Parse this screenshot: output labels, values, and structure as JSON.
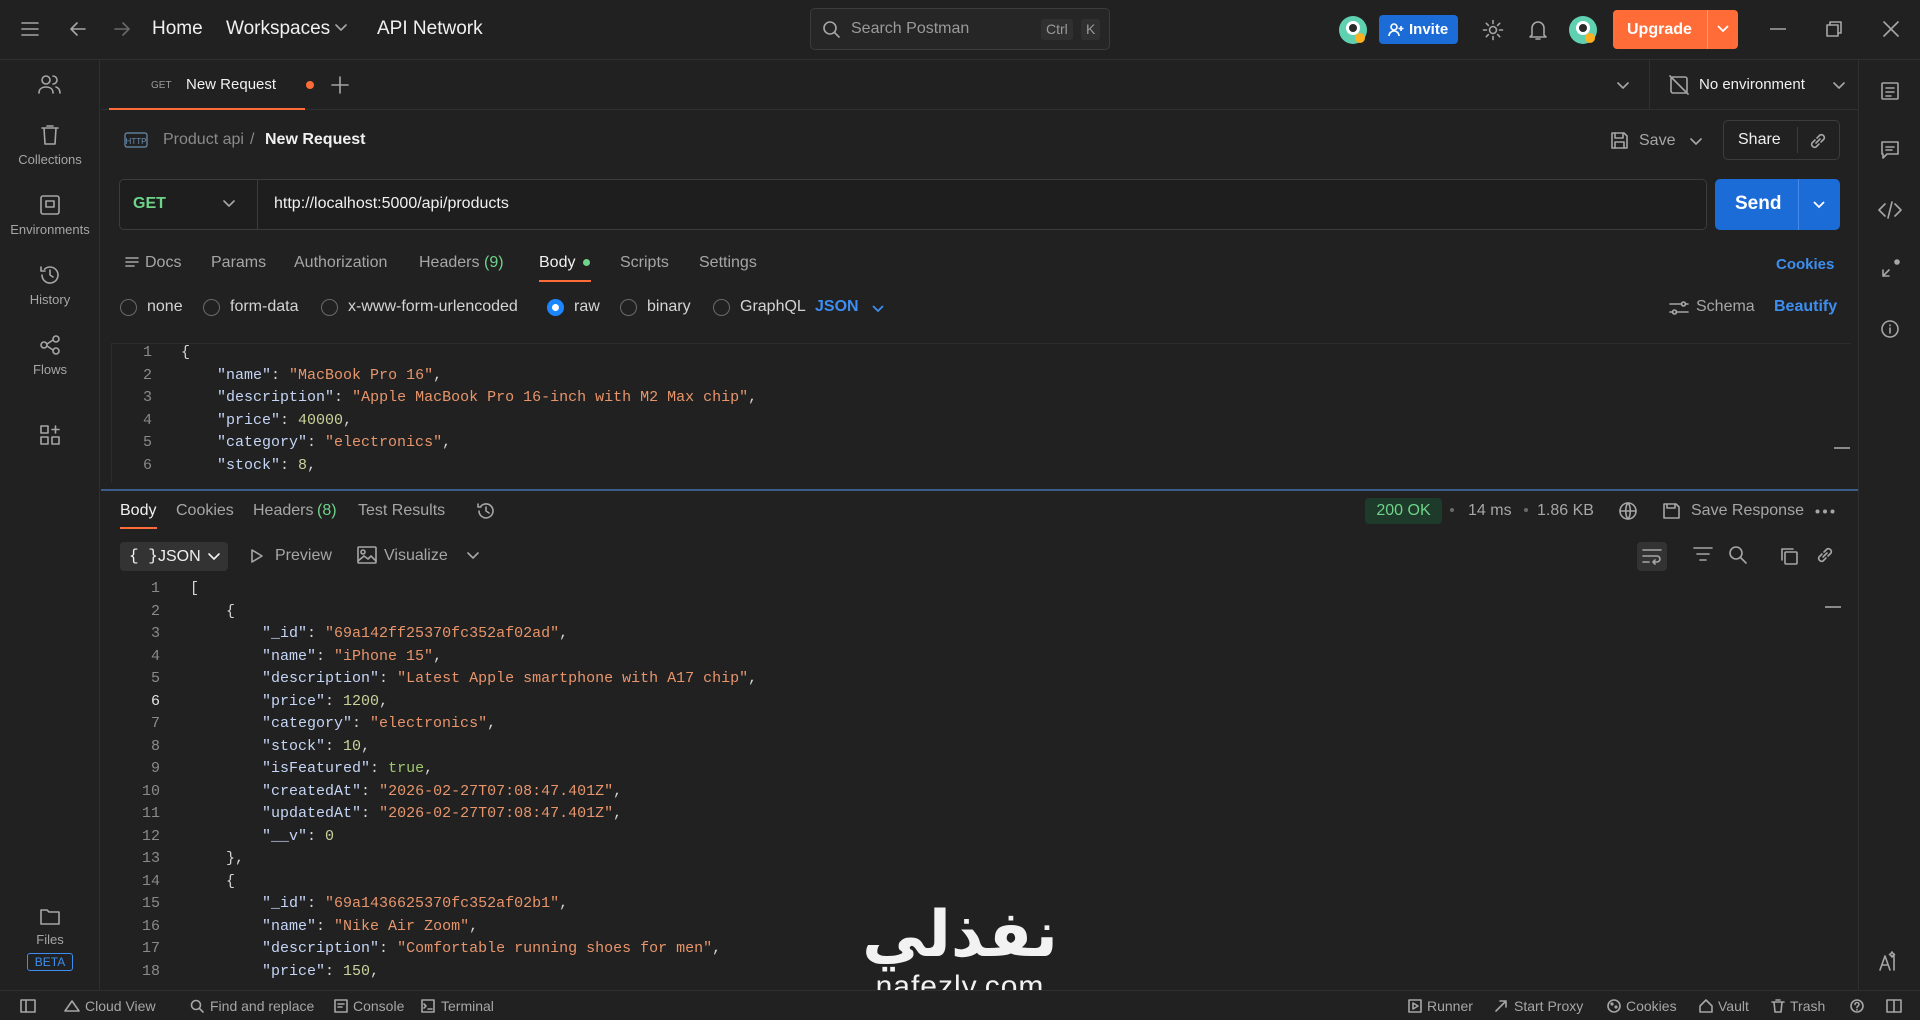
{
  "topbar": {
    "home": "Home",
    "workspaces": "Workspaces",
    "api_network": "API Network",
    "search_placeholder": "Search Postman",
    "kbd_ctrl": "Ctrl",
    "kbd_k": "K",
    "invite": "Invite",
    "upgrade": "Upgrade"
  },
  "sidebar": {
    "items": [
      {
        "label": "Collections"
      },
      {
        "label": "Environments"
      },
      {
        "label": "History"
      },
      {
        "label": "Flows"
      }
    ],
    "files": "Files",
    "beta": "BETA"
  },
  "tabs": {
    "active_method": "GET",
    "active_title": "New Request",
    "environment": "No environment"
  },
  "request": {
    "breadcrumb_collection": "Product api",
    "breadcrumb_sep": "/",
    "breadcrumb_request": "New Request",
    "save": "Save",
    "share": "Share",
    "method": "GET",
    "url": "http://localhost:5000/api/products",
    "send": "Send"
  },
  "req_tabs": {
    "docs": "Docs",
    "params": "Params",
    "authorization": "Authorization",
    "headers": "Headers",
    "headers_count": "(9)",
    "body": "Body",
    "scripts": "Scripts",
    "settings": "Settings",
    "cookies": "Cookies"
  },
  "body_modes": {
    "none": "none",
    "form_data": "form-data",
    "urlencoded": "x-www-form-urlencoded",
    "raw": "raw",
    "binary": "binary",
    "graphql": "GraphQL",
    "format": "JSON",
    "schema": "Schema",
    "beautify": "Beautify"
  },
  "request_body": [
    {
      "ln": "1",
      "parts": [
        [
          "p",
          "{"
        ]
      ]
    },
    {
      "ln": "2",
      "parts": [
        [
          "p",
          "    "
        ],
        [
          "k",
          "\"name\""
        ],
        [
          "p",
          ": "
        ],
        [
          "s",
          "\"MacBook Pro 16\""
        ],
        [
          "p",
          ","
        ]
      ]
    },
    {
      "ln": "3",
      "parts": [
        [
          "p",
          "    "
        ],
        [
          "k",
          "\"description\""
        ],
        [
          "p",
          ": "
        ],
        [
          "s",
          "\"Apple MacBook Pro 16-inch with M2 Max chip\""
        ],
        [
          "p",
          ","
        ]
      ]
    },
    {
      "ln": "4",
      "parts": [
        [
          "p",
          "    "
        ],
        [
          "k",
          "\"price\""
        ],
        [
          "p",
          ": "
        ],
        [
          "n",
          "40000"
        ],
        [
          "p",
          ","
        ]
      ]
    },
    {
      "ln": "5",
      "parts": [
        [
          "p",
          "    "
        ],
        [
          "k",
          "\"category\""
        ],
        [
          "p",
          ": "
        ],
        [
          "s",
          "\"electronics\""
        ],
        [
          "p",
          ","
        ]
      ]
    },
    {
      "ln": "6",
      "parts": [
        [
          "p",
          "    "
        ],
        [
          "k",
          "\"stock\""
        ],
        [
          "p",
          ": "
        ],
        [
          "n",
          "8"
        ],
        [
          "p",
          ","
        ]
      ]
    }
  ],
  "response": {
    "tabs": {
      "body": "Body",
      "cookies": "Cookies",
      "headers": "Headers",
      "headers_count": "(8)",
      "test_results": "Test Results"
    },
    "status": "200 OK",
    "time": "14 ms",
    "size": "1.86 KB",
    "save_response": "Save Response",
    "format": "JSON",
    "preview": "Preview",
    "visualize": "Visualize",
    "lines": [
      {
        "ln": "1",
        "parts": [
          [
            "p",
            "["
          ]
        ]
      },
      {
        "ln": "2",
        "parts": [
          [
            "p",
            "    {"
          ]
        ]
      },
      {
        "ln": "3",
        "parts": [
          [
            "p",
            "        "
          ],
          [
            "k",
            "\"_id\""
          ],
          [
            "p",
            ": "
          ],
          [
            "s",
            "\"69a142ff25370fc352af02ad\""
          ],
          [
            "p",
            ","
          ]
        ]
      },
      {
        "ln": "4",
        "parts": [
          [
            "p",
            "        "
          ],
          [
            "k",
            "\"name\""
          ],
          [
            "p",
            ": "
          ],
          [
            "s",
            "\"iPhone 15\""
          ],
          [
            "p",
            ","
          ]
        ]
      },
      {
        "ln": "5",
        "parts": [
          [
            "p",
            "        "
          ],
          [
            "k",
            "\"description\""
          ],
          [
            "p",
            ": "
          ],
          [
            "s",
            "\"Latest Apple smartphone with A17 chip\""
          ],
          [
            "p",
            ","
          ]
        ]
      },
      {
        "ln": "6",
        "parts": [
          [
            "p",
            "        "
          ],
          [
            "k",
            "\"price\""
          ],
          [
            "p",
            ": "
          ],
          [
            "n",
            "1200"
          ],
          [
            "p",
            ","
          ]
        ]
      },
      {
        "ln": "7",
        "parts": [
          [
            "p",
            "        "
          ],
          [
            "k",
            "\"category\""
          ],
          [
            "p",
            ": "
          ],
          [
            "s",
            "\"electronics\""
          ],
          [
            "p",
            ","
          ]
        ]
      },
      {
        "ln": "8",
        "parts": [
          [
            "p",
            "        "
          ],
          [
            "k",
            "\"stock\""
          ],
          [
            "p",
            ": "
          ],
          [
            "n",
            "10"
          ],
          [
            "p",
            ","
          ]
        ]
      },
      {
        "ln": "9",
        "parts": [
          [
            "p",
            "        "
          ],
          [
            "k",
            "\"isFeatured\""
          ],
          [
            "p",
            ": "
          ],
          [
            "b",
            "true"
          ],
          [
            "p",
            ","
          ]
        ]
      },
      {
        "ln": "10",
        "parts": [
          [
            "p",
            "        "
          ],
          [
            "k",
            "\"createdAt\""
          ],
          [
            "p",
            ": "
          ],
          [
            "s",
            "\"2026-02-27T07:08:47.401Z\""
          ],
          [
            "p",
            ","
          ]
        ]
      },
      {
        "ln": "11",
        "parts": [
          [
            "p",
            "        "
          ],
          [
            "k",
            "\"updatedAt\""
          ],
          [
            "p",
            ": "
          ],
          [
            "s",
            "\"2026-02-27T07:08:47.401Z\""
          ],
          [
            "p",
            ","
          ]
        ]
      },
      {
        "ln": "12",
        "parts": [
          [
            "p",
            "        "
          ],
          [
            "k",
            "\"__v\""
          ],
          [
            "p",
            ": "
          ],
          [
            "n",
            "0"
          ]
        ]
      },
      {
        "ln": "13",
        "parts": [
          [
            "p",
            "    },"
          ]
        ]
      },
      {
        "ln": "14",
        "parts": [
          [
            "p",
            "    {"
          ]
        ]
      },
      {
        "ln": "15",
        "parts": [
          [
            "p",
            "        "
          ],
          [
            "k",
            "\"_id\""
          ],
          [
            "p",
            ": "
          ],
          [
            "s",
            "\"69a1436625370fc352af02b1\""
          ],
          [
            "p",
            ","
          ]
        ]
      },
      {
        "ln": "16",
        "parts": [
          [
            "p",
            "        "
          ],
          [
            "k",
            "\"name\""
          ],
          [
            "p",
            ": "
          ],
          [
            "s",
            "\"Nike Air Zoom\""
          ],
          [
            "p",
            ","
          ]
        ]
      },
      {
        "ln": "17",
        "parts": [
          [
            "p",
            "        "
          ],
          [
            "k",
            "\"description\""
          ],
          [
            "p",
            ": "
          ],
          [
            "s",
            "\"Comfortable running shoes for men\""
          ],
          [
            "p",
            ","
          ]
        ]
      },
      {
        "ln": "18",
        "parts": [
          [
            "p",
            "        "
          ],
          [
            "k",
            "\"price\""
          ],
          [
            "p",
            ": "
          ],
          [
            "n",
            "150"
          ],
          [
            "p",
            ","
          ]
        ]
      }
    ]
  },
  "statusbar": {
    "cloud_view": "Cloud View",
    "find_replace": "Find and replace",
    "console": "Console",
    "terminal": "Terminal",
    "runner": "Runner",
    "start_proxy": "Start Proxy",
    "cookies": "Cookies",
    "vault": "Vault",
    "trash": "Trash"
  },
  "watermark": {
    "arabic": "نفذلي",
    "latin": "nafezly.com"
  },
  "colors": {
    "accent": "#ff6c37",
    "primary": "#1c6cd8",
    "get_method": "#6fd38a",
    "link": "#3d8ef0"
  }
}
